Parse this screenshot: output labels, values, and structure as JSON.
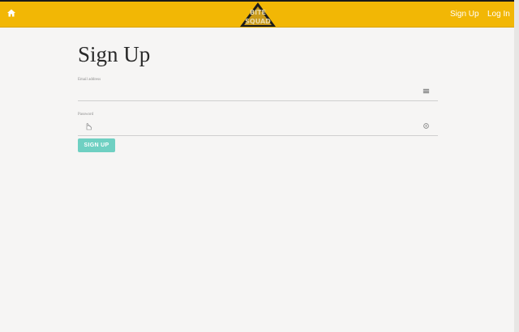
{
  "nav": {
    "logo_line1": "BITE",
    "logo_line2": "SQUAD",
    "signup_label": "Sign Up",
    "login_label": "Log In",
    "bar_color": "#f2b705"
  },
  "form": {
    "title": "Sign Up",
    "email_label": "Email address",
    "email_value": "",
    "email_placeholder": "",
    "email_icon": "card-icon",
    "password_label": "Password",
    "password_value": "",
    "password_placeholder": "",
    "password_icon": "eye-icon",
    "submit_label": "SIGN UP",
    "button_color": "#6fd0c2"
  }
}
